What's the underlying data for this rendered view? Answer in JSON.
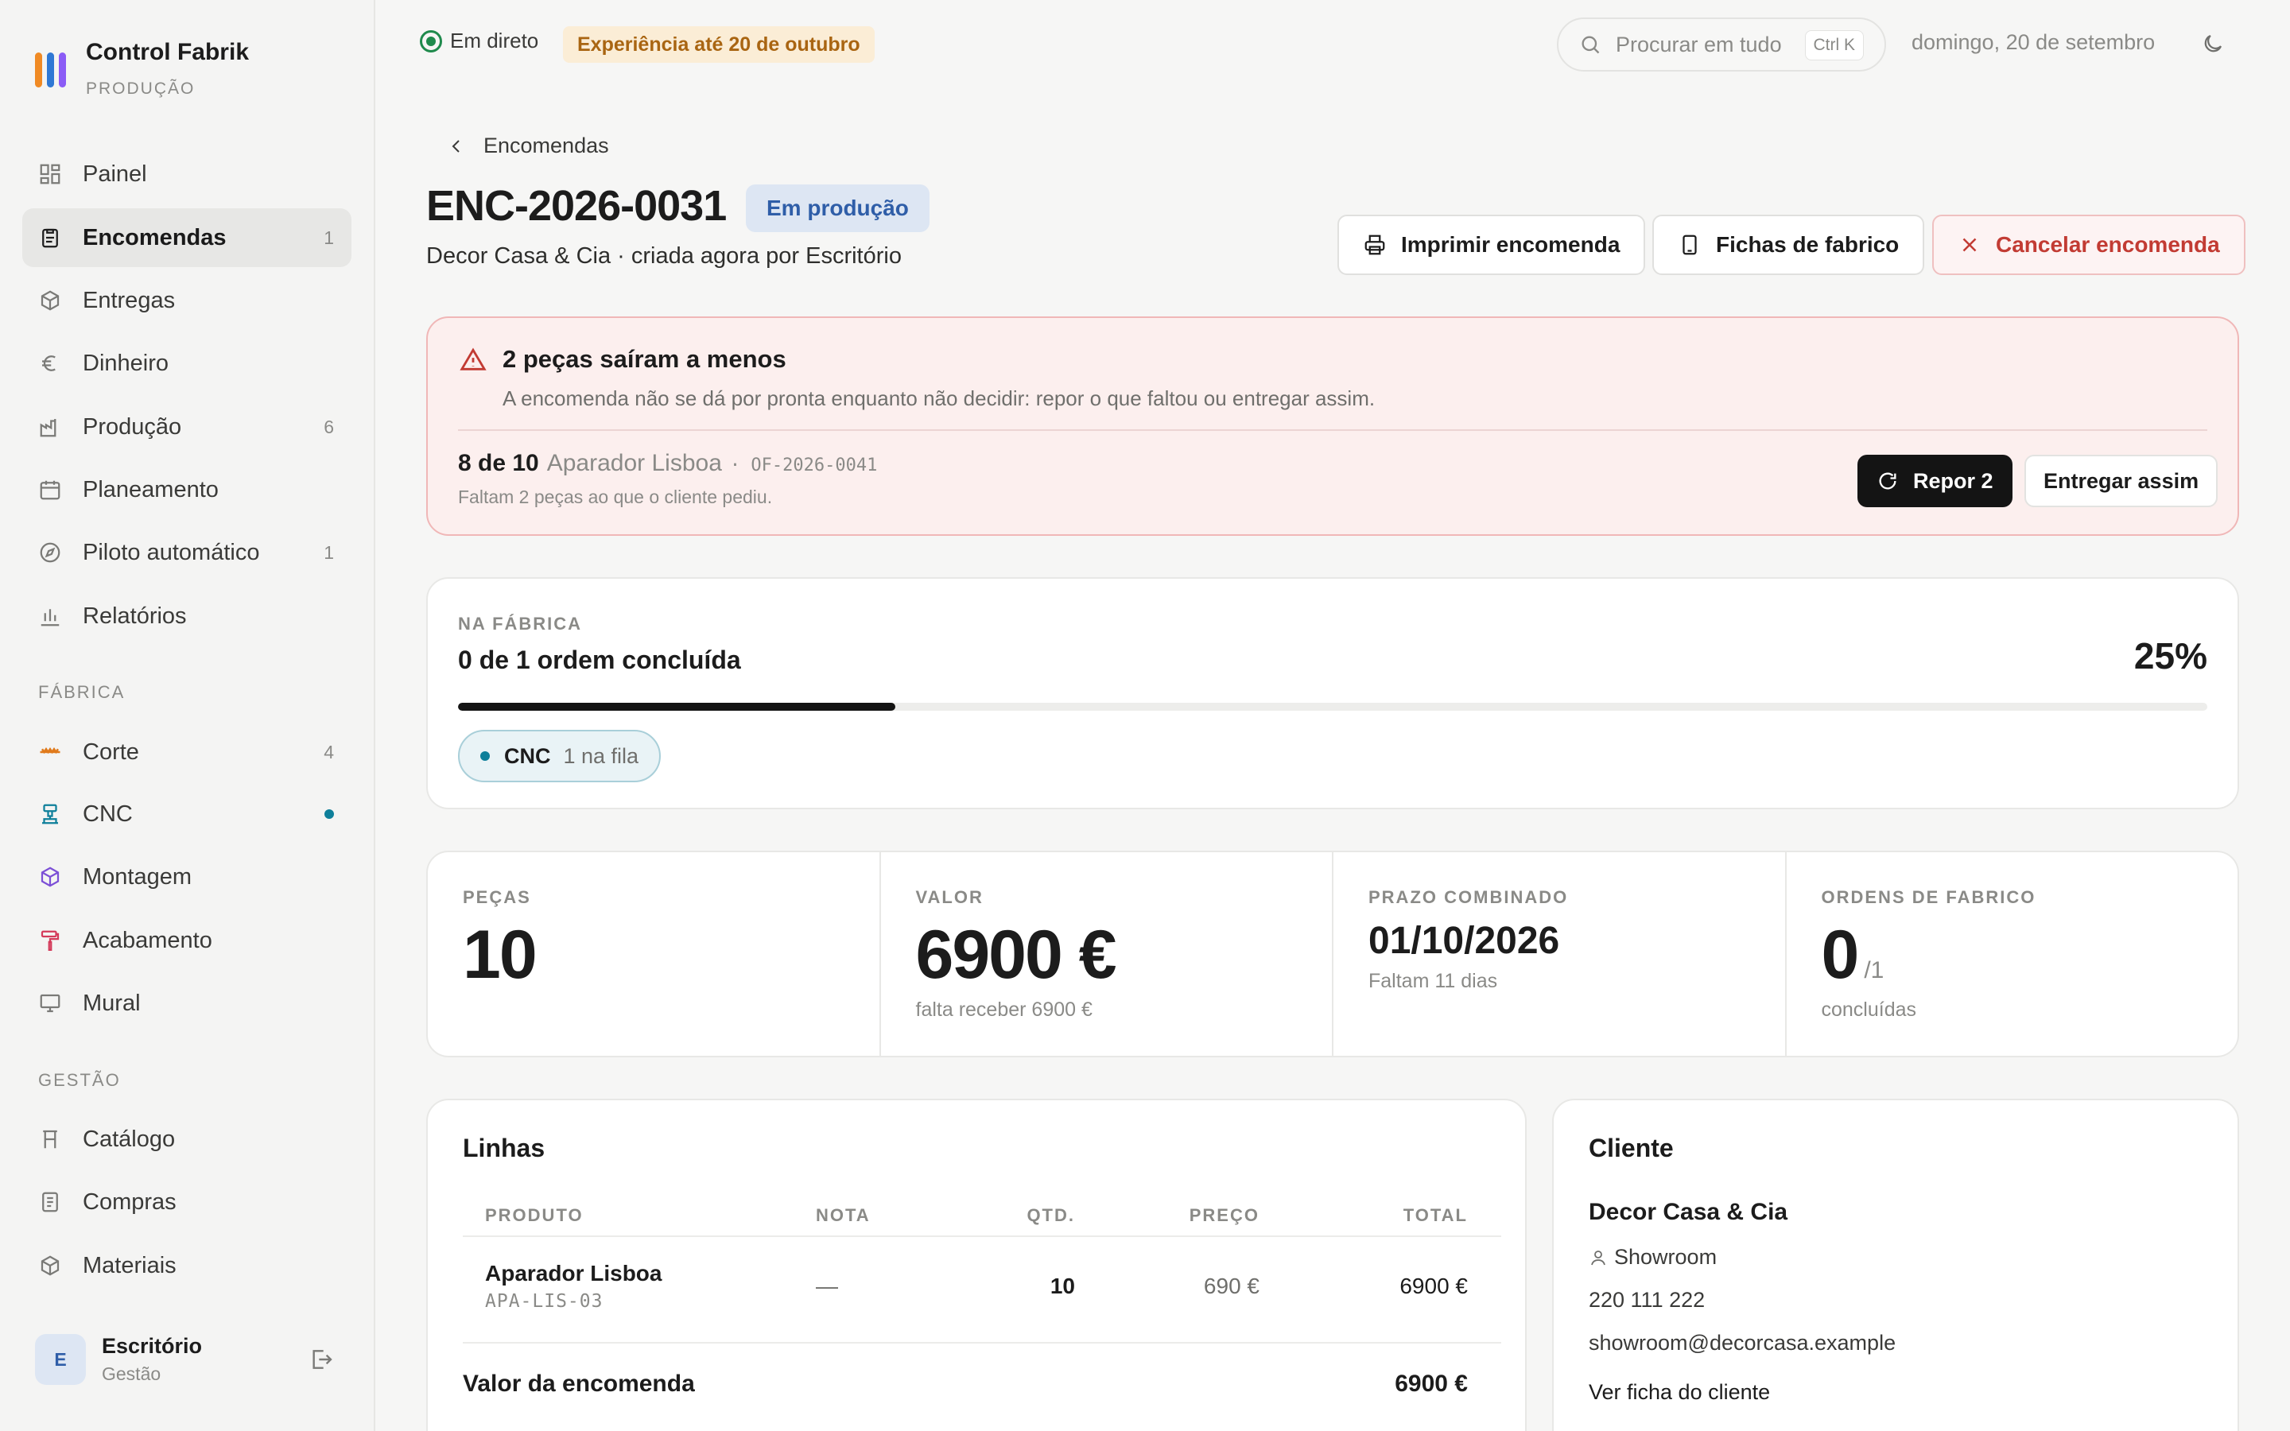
{
  "brand": {
    "name": "Control Fabrik",
    "subtitle": "PRODUÇÃO",
    "colors": [
      "#f08a24",
      "#2f78d4",
      "#8b5cf6"
    ]
  },
  "nav": {
    "main": [
      {
        "label": "Painel",
        "icon": "dashboard-icon",
        "count": ""
      },
      {
        "label": "Encomendas",
        "icon": "clipboard-icon",
        "count": "1",
        "active": true
      },
      {
        "label": "Entregas",
        "icon": "box-icon",
        "count": ""
      },
      {
        "label": "Dinheiro",
        "icon": "euro-icon",
        "count": ""
      },
      {
        "label": "Produção",
        "icon": "factory-icon",
        "count": "6"
      },
      {
        "label": "Planeamento",
        "icon": "calendar-icon",
        "count": ""
      },
      {
        "label": "Piloto automático",
        "icon": "compass-icon",
        "count": "1"
      },
      {
        "label": "Relatórios",
        "icon": "bar-chart-icon",
        "count": ""
      }
    ],
    "factory_section": "FÁBRICA",
    "factory": [
      {
        "label": "Corte",
        "icon": "saw-icon",
        "count": "4",
        "color": "#e07a1b"
      },
      {
        "label": "CNC",
        "icon": "cnc-icon",
        "dot": true,
        "color": "#0e7f9a"
      },
      {
        "label": "Montagem",
        "icon": "cube-icon",
        "color": "#7c4fd6"
      },
      {
        "label": "Acabamento",
        "icon": "paint-roller-icon",
        "color": "#d43a5a"
      },
      {
        "label": "Mural",
        "icon": "monitor-icon",
        "color": "#6f6f6c"
      }
    ],
    "management_section": "GESTÃO",
    "management": [
      {
        "label": "Catálogo",
        "icon": "chair-icon"
      },
      {
        "label": "Compras",
        "icon": "receipt-icon"
      },
      {
        "label": "Materiais",
        "icon": "box-icon"
      }
    ]
  },
  "user": {
    "initial": "E",
    "name": "Escritório",
    "role": "Gestão"
  },
  "topbar": {
    "live": "Em direto",
    "trial": "Experiência até 20 de outubro",
    "search_placeholder": "Procurar em tudo",
    "shortcut": "Ctrl K",
    "date": "domingo, 20 de setembro"
  },
  "header": {
    "back": "Encomendas",
    "order_id": "ENC-2026-0031",
    "status": "Em produção",
    "subtitle": "Decor Casa & Cia · criada agora por Escritório",
    "print": "Imprimir encomenda",
    "sheets": "Fichas de fabrico",
    "cancel": "Cancelar encomenda"
  },
  "alert": {
    "title": "2 peças saíram a menos",
    "description": "A encomenda não se dá por pronta enquanto não decidir: repor o que faltou ou entregar assim.",
    "qty": "8 de 10",
    "product": "Aparador Lisboa",
    "ref": "· OF-2026-0041",
    "missing": "Faltam 2 peças ao que o cliente pediu.",
    "restock": "Repor 2",
    "deliver": "Entregar assim"
  },
  "factory": {
    "eyebrow": "NA FÁBRICA",
    "title": "0 de 1 ordem concluída",
    "percent_label": "25%",
    "progress": 0.25,
    "chip_name": "CNC",
    "chip_queue": "1 na fila"
  },
  "stats": {
    "pieces_label": "PEÇAS",
    "pieces": "10",
    "value_label": "VALOR",
    "value": "6900 €",
    "value_sub": "falta receber 6900 €",
    "deadline_label": "PRAZO COMBINADO",
    "deadline": "01/10/2026",
    "deadline_sub": "Faltam 11 dias",
    "orders_label": "ORDENS DE FABRICO",
    "orders": "0",
    "orders_of": "/1",
    "orders_sub": "concluídas"
  },
  "lines": {
    "title": "Linhas",
    "headers": {
      "product": "PRODUTO",
      "note": "NOTA",
      "qty": "QTD.",
      "price": "PREÇO",
      "total": "TOTAL"
    },
    "rows": [
      {
        "product": "Aparador Lisboa",
        "sku": "APA-LIS-03",
        "note": "—",
        "qty": "10",
        "price": "690 €",
        "total": "6900 €"
      }
    ],
    "footer_label": "Valor da encomenda",
    "footer_total": "6900 €"
  },
  "client": {
    "title": "Cliente",
    "name": "Decor Casa & Cia",
    "contact": "Showroom",
    "phone": "220 111 222",
    "email": "showroom@decorcasa.example",
    "link": "Ver ficha do cliente"
  }
}
